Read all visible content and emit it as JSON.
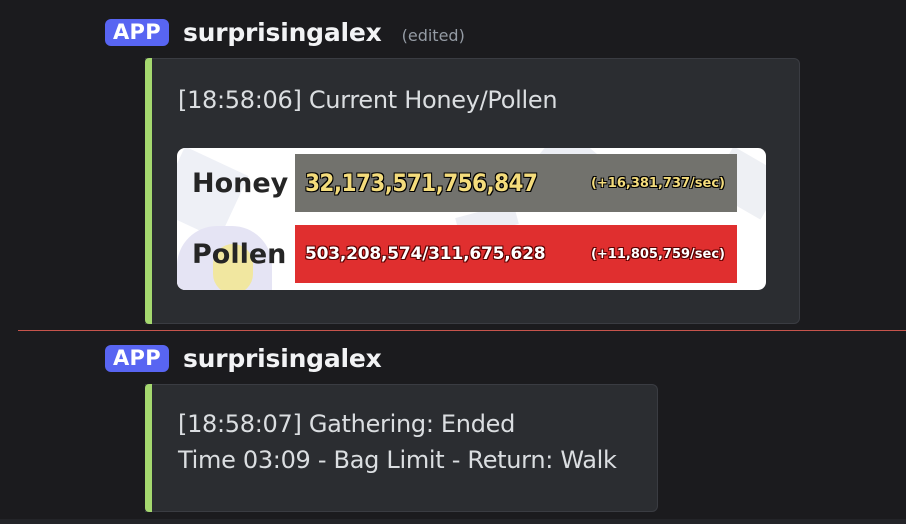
{
  "colors": {
    "background": "#1b1b1e",
    "app_badge": "#5865f2",
    "embed_accent": "#a5d86f",
    "embed_bg": "#2b2d31",
    "new_messages_divider": "#c6544c",
    "honey_bar": "#72726d",
    "pollen_bar": "#e02f2f"
  },
  "messages": [
    {
      "badge": "APP",
      "username": "surprisingalex",
      "edited": "(edited)",
      "embed": {
        "title": "[18:58:06] Current Honey/Pollen",
        "image": {
          "honey_label": "Honey",
          "honey_value": "32,173,571,756,847",
          "honey_rate": "(+16,381,737/sec)",
          "pollen_label": "Pollen",
          "pollen_value": "503,208,574/311,675,628",
          "pollen_rate": "(+11,805,759/sec)"
        }
      }
    },
    {
      "badge": "APP",
      "username": "surprisingalex",
      "embed": {
        "line1": "[18:58:07] Gathering: Ended",
        "line2": "Time 03:09 - Bag Limit - Return: Walk"
      }
    }
  ]
}
